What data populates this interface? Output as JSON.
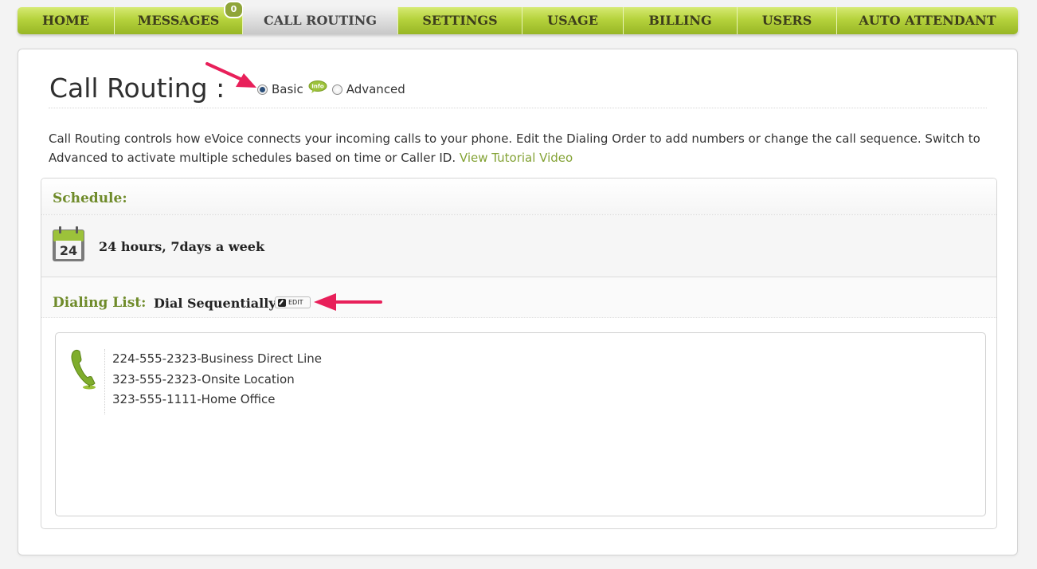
{
  "nav": {
    "items": [
      {
        "label": "HOME",
        "active": false
      },
      {
        "label": "MESSAGES",
        "active": false
      },
      {
        "label": "CALL ROUTING",
        "active": true
      },
      {
        "label": "SETTINGS",
        "active": false
      },
      {
        "label": "USAGE",
        "active": false
      },
      {
        "label": "BILLING",
        "active": false
      },
      {
        "label": "USERS",
        "active": false
      },
      {
        "label": "AUTO ATTENDANT",
        "active": false
      }
    ],
    "messages_badge": "0"
  },
  "page": {
    "title": "Call Routing :",
    "mode_options": [
      {
        "label": "Basic",
        "selected": true
      },
      {
        "label": "Advanced",
        "selected": false
      }
    ],
    "info_badge": "Info",
    "description": "Call Routing controls how eVoice connects your incoming calls to your phone. Edit the Dialing Order to add numbers or change the call sequence. Switch to Advanced to activate multiple schedules based on time or Caller ID.",
    "tutorial_link": "View Tutorial Video"
  },
  "schedule": {
    "heading": "Schedule:",
    "calendar_day": "24",
    "text": "24 hours, 7days a week"
  },
  "dialing": {
    "heading": "Dialing List:",
    "mode": "Dial Sequentially",
    "edit_label": "EDIT",
    "numbers": [
      "224-555-2323-Business Direct Line",
      "323-555-2323-Onsite Location",
      "323-555-1111-Home Office"
    ]
  },
  "colors": {
    "nav_green": "#b5d23c",
    "label_green": "#6f8b2a",
    "link_green": "#84a336",
    "arrow_red": "#e8205a"
  },
  "icons": [
    "info-bubble-icon",
    "calendar-icon",
    "edit-icon",
    "phone-icon"
  ]
}
